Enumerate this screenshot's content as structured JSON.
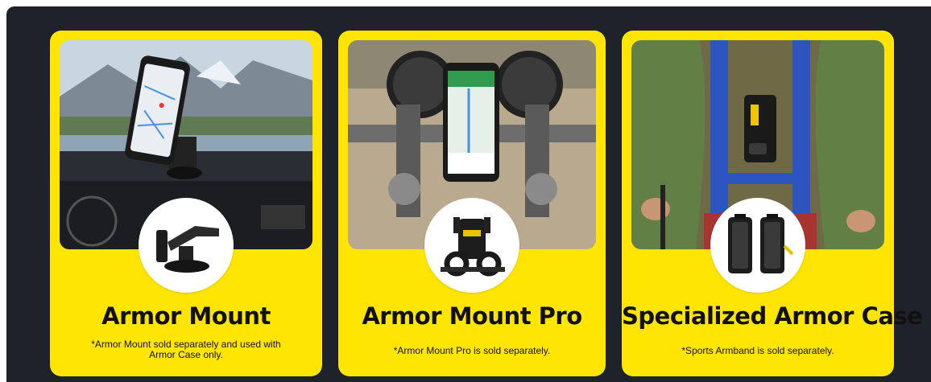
{
  "cards": [
    {
      "title": "Armor Mount",
      "note": "*Armor Mount sold separately and used with Armor Case only.",
      "photo_icon": "car-dashboard-phone-mount-image",
      "product_icon": "suction-cup-mount-icon"
    },
    {
      "title": "Armor Mount Pro",
      "note": "*Armor Mount Pro is sold separately.",
      "photo_icon": "motorcycle-handlebar-phone-mount-image",
      "product_icon": "handlebar-clamp-mount-icon"
    },
    {
      "title": "Specialized Armor Case",
      "note": "*Sports Armband is sold separately.",
      "photo_icon": "hiker-chest-phone-case-image",
      "product_icon": "armor-case-icon"
    }
  ],
  "colors": {
    "background": "#1e232b",
    "card": "#ffe501",
    "text": "#111111"
  }
}
